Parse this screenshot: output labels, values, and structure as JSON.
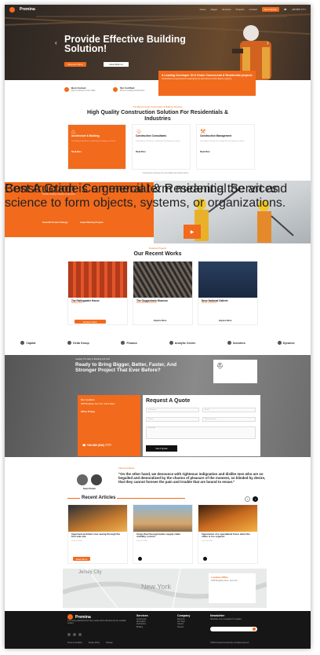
{
  "brand": {
    "name": "Premina",
    "accent": "#f26a1b"
  },
  "hero": {
    "title": "Provide Effective Building Solution!",
    "cta": "Get A Quote",
    "btn1": "Discover More",
    "btn2": "About Work Us"
  },
  "hero_box": {
    "title": "A Leading Developer Of A Grade Commercial & Residential projects",
    "text": "Construction is a general term meaning the art and science to form objects, systems."
  },
  "features": [
    {
      "title": "Best Contact",
      "text": "Best Contractor At Our Office"
    },
    {
      "title": "Our Certified",
      "text": "We're A Leading Construction"
    }
  ],
  "services": {
    "kicker": "The Best & Great Construction & Building Services",
    "title": "High Quality Construction Solution For Residentials & Industries",
    "cards": [
      {
        "title": "Architecture & Building",
        "text": "Consulting is based on a simple idea of helping our clients.",
        "more": "Read More"
      },
      {
        "title": "Construction Consultants",
        "text": "Consulting is based on a simple idea of helping our clients.",
        "more": "Read More"
      },
      {
        "title": "Construction Management",
        "text": "Consulting is based on a simple idea of helping our clients.",
        "more": "Read More"
      }
    ],
    "footer": "Construction services for more Build Your Dream Home"
  },
  "band": {
    "kicker": "Worlds Leading Industry Corporation",
    "title": "Best A Grade Commercial & Residential Services",
    "text": "Construction is a general term meaning the art and science to form objects, systems, or organizations.",
    "f1": "Powerful Product Strategy",
    "f2": "Award Winning Projects"
  },
  "works": {
    "kicker": "Featured Projects",
    "title": "Our Recent Works",
    "items": [
      {
        "title": "The Fallingwater House",
        "cat": "Building Work",
        "more": "Explore More"
      },
      {
        "title": "The Guggenheim Museum",
        "cat": "Renovation, Construction",
        "more": "Explore More"
      },
      {
        "title": "Neue National Gallerie",
        "cat": "Interior & Structure",
        "more": "Explore More"
      }
    ]
  },
  "logos": [
    "Capital",
    "Delta Group",
    "Finance",
    "Analytic Center",
    "Investors",
    "Dynamic"
  ],
  "cta": {
    "kicker": "Leading The Way In Building And Civil",
    "title": "Ready to Bring Bigger, Better, Faster, And Stronger Project That Ever Before?"
  },
  "quote": {
    "title": "Request A Quote",
    "office_label": "Our Location",
    "office": "1055 Broadway, New York, United States",
    "hours": "Office Timing",
    "phone": "+88 888 (546) 7777",
    "fields": [
      "Full Name",
      "Email",
      "Phone",
      "Select Services",
      "Message"
    ],
    "submit": "Get A Quote"
  },
  "testimonial": {
    "kicker": "Clients Feedback",
    "text": "\"On the other hand, we denounce with righteous indignation and dislike men who are so beguiled and demoralized by the charms of pleasure of the moment, so blinded by desire, that they cannot foresee the pain and trouble that are bound to ensue.\"",
    "name": "Sean Parker"
  },
  "articles": {
    "title": "Recent Articles",
    "items": [
      {
        "title": "Important architect cost saving through the first sale rule",
        "date": "June 24, 2024"
      },
      {
        "title": "Cargo flow through better supply chain visibility, control",
        "date": "June 24, 2024"
      },
      {
        "title": "Importance of a specialized focus when the office is too organic!",
        "date": "June 24, 2024"
      }
    ],
    "more": "Read More"
  },
  "map": {
    "city1": "Jersey City",
    "city2": "New York",
    "box_title": "Location Office",
    "box_text": "1055 Broadway Street, New York"
  },
  "footer": {
    "about": "It is a long established fact that a reader will be distracted by the readable content.",
    "col1": "Services",
    "col2": "Company",
    "col3": "Newsletter",
    "links1": [
      "Construction",
      "Renovation",
      "Architecture",
      "Building",
      "Interior Design"
    ],
    "links2": [
      "About Us",
      "Our Team",
      "Careers",
      "Projects",
      "Contact"
    ],
    "news": "Subscribe to our newsletter for updates.",
    "copy": "©2024 Premina Construction. All rights reserved.",
    "bottom": [
      "Terms & Condition",
      "Privacy Policy",
      "Sitemap"
    ]
  }
}
